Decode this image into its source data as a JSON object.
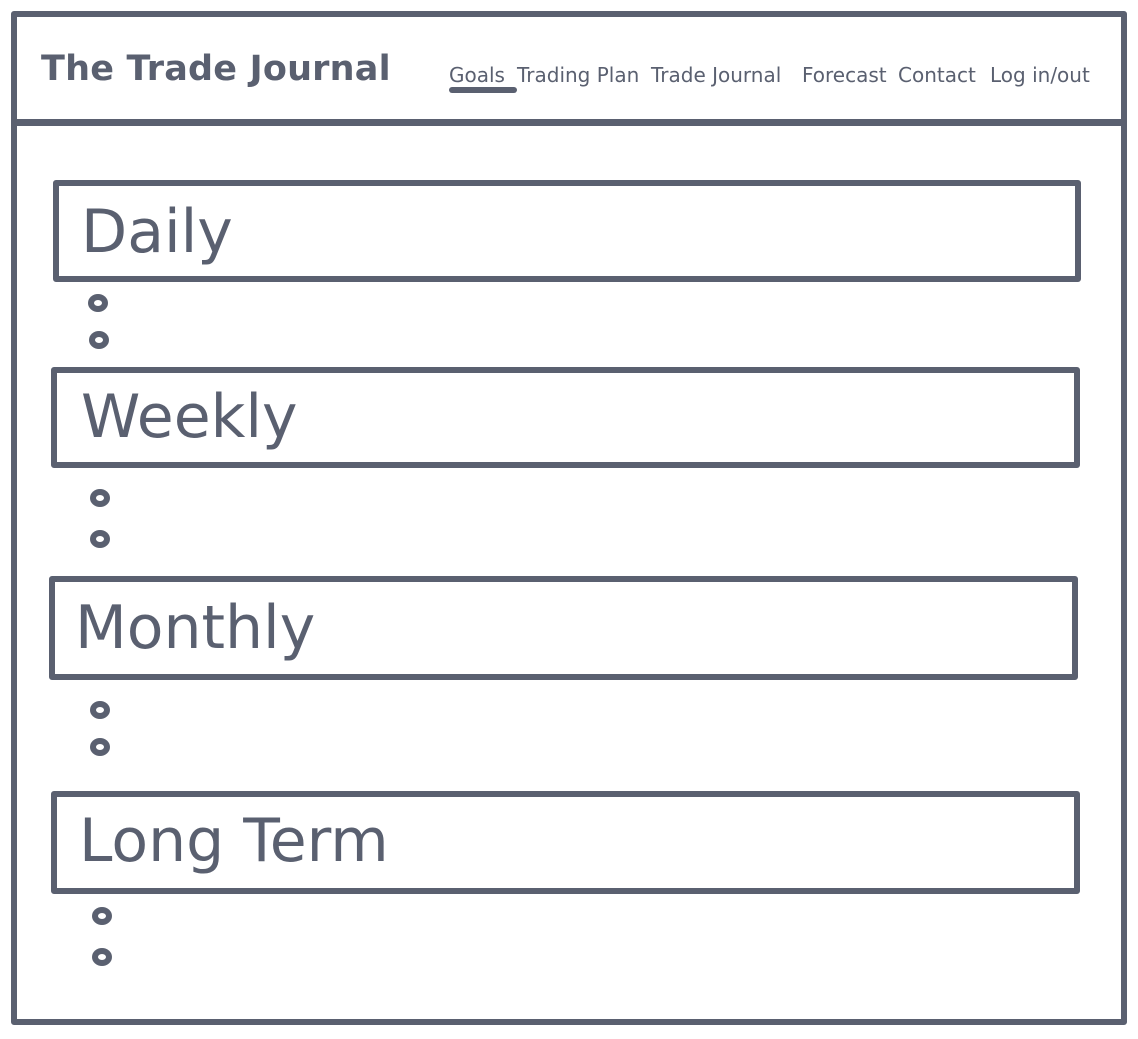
{
  "header": {
    "title": "The Trade Journal",
    "nav": [
      {
        "label": "Goals",
        "active": true
      },
      {
        "label": "Trading Plan",
        "active": false
      },
      {
        "label": "Trade Journal",
        "active": false
      },
      {
        "label": "Forecast",
        "active": false
      },
      {
        "label": "Contact",
        "active": false
      },
      {
        "label": "Log in/out",
        "active": false
      }
    ]
  },
  "sections": [
    {
      "title": "Daily",
      "bullets": 2
    },
    {
      "title": "Weekly",
      "bullets": 2
    },
    {
      "title": "Monthly",
      "bullets": 2
    },
    {
      "title": "Long Term",
      "bullets": 2
    }
  ],
  "colors": {
    "ink": "#5a6070",
    "background": "#ffffff"
  }
}
